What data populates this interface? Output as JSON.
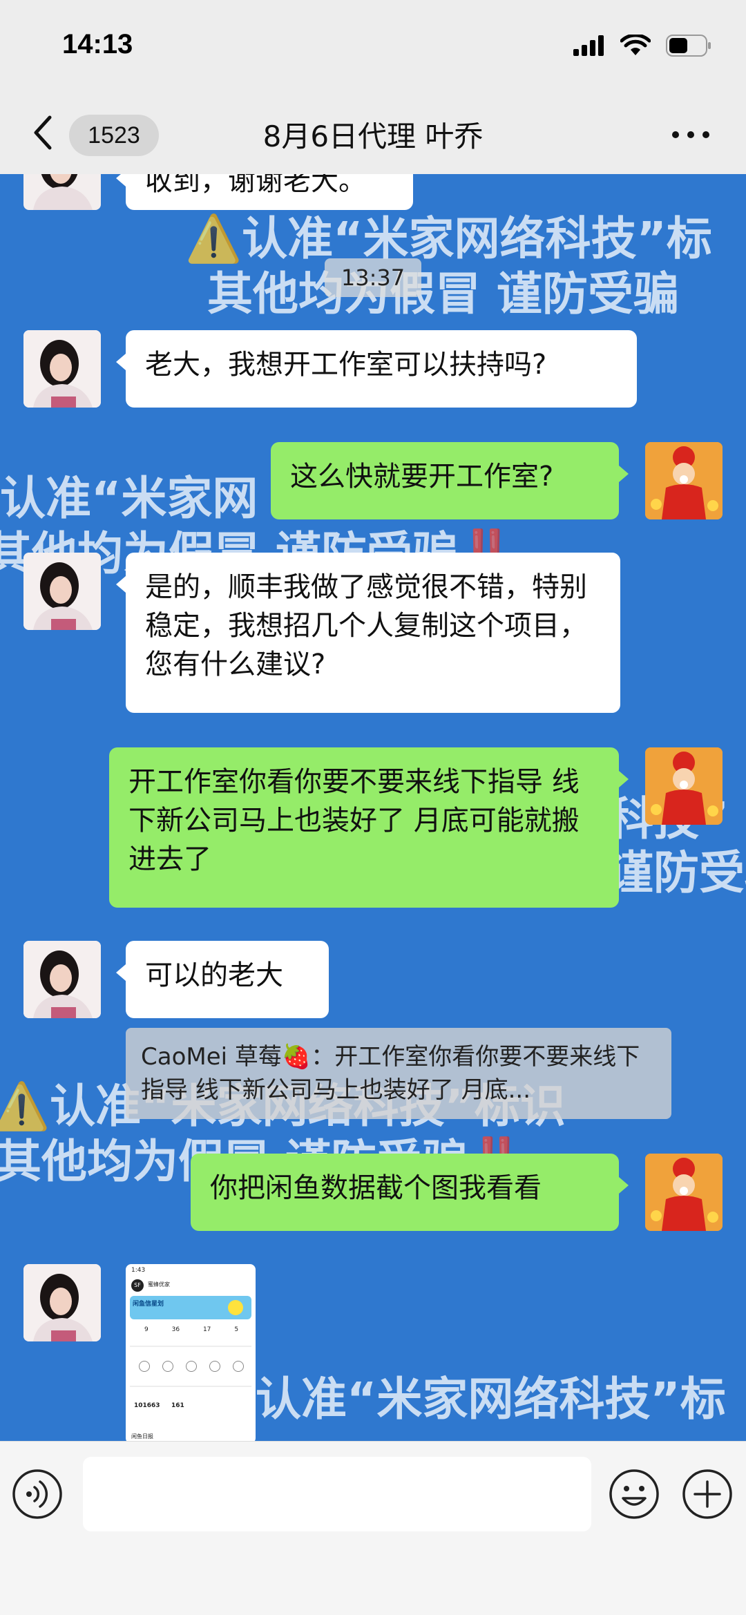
{
  "status": {
    "time": "14:13"
  },
  "nav": {
    "badge": "1523",
    "title": "8月6日代理 叶乔"
  },
  "chat": {
    "partial_message": "收到，谢谢老大。",
    "timestamp": "13:37",
    "watermarks": [
      "⚠️认准“米家网络科技”标",
      "其他均为假冒 谨防受骗",
      "认准“米家网",
      "其他均为假冒 谨防受骗‼️",
      "科技”",
      "谨防受骗",
      "⚠️认准“米家网络科技”标识",
      "其他均为假冒 谨防受骗‼️",
      "认准“米家网络科技”标"
    ],
    "messages": [
      {
        "side": "left",
        "text": "老大，我想开工作室可以扶持吗?"
      },
      {
        "side": "right",
        "text": "这么快就要开工作室?"
      },
      {
        "side": "left",
        "text": "是的，顺丰我做了感觉很不错，特别稳定，我想招几个人复制这个项目，您有什么建议?"
      },
      {
        "side": "right",
        "text": "开工作室你看你要不要来线下指导 线下新公司马上也装好了 月底可能就搬进去了"
      },
      {
        "side": "left",
        "text": "可以的老大"
      },
      {
        "side": "right",
        "text": "你把闲鱼数据截个图我看看"
      }
    ],
    "quote": {
      "author": "CaoMei 草莓🍓",
      "text": "：开工作室你看你要不要来线下指导 线下新公司马上也装好了 月底..."
    },
    "screenshot": {
      "time": "1:43",
      "logo": "SF",
      "shop": "蜜蜂优家",
      "banner": "闲鱼信星划",
      "stats": [
        "9",
        "36",
        "17",
        "5"
      ],
      "numbers": [
        "101663",
        "161"
      ],
      "footer": "闲鱼日报"
    }
  },
  "icons": {
    "back": "chevron-left-icon",
    "more": "more-dots-icon",
    "voice": "voice-icon",
    "emoji": "emoji-icon",
    "plus": "plus-icon"
  },
  "colors": {
    "chat_bg": "#2f78cf",
    "green_bubble": "#95ec69",
    "white_bubble": "#ffffff"
  }
}
